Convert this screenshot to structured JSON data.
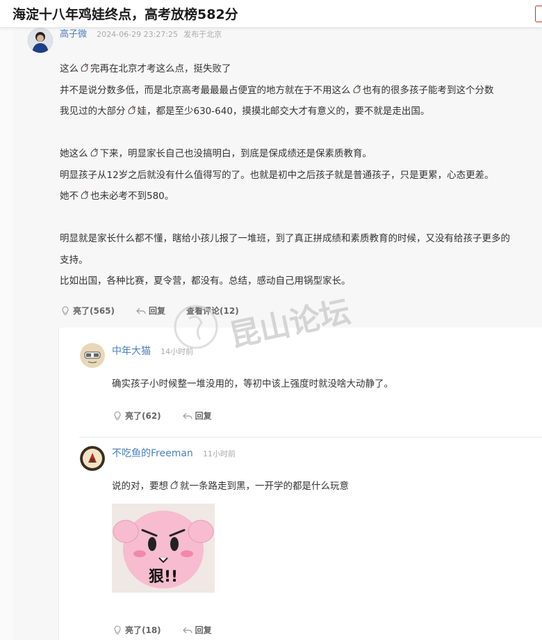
{
  "page": {
    "title": "海淀十八年鸡娃终点，高考放榜582分"
  },
  "post": {
    "author": "高子微",
    "time": "2024-06-29 23:27:25",
    "location": "发布于北京",
    "lines": [
      "这么[鸡]完再在北京才考这么点，挺失败了",
      "并不是说分数多低，而是北京高考最最最占便宜的地方就在于不用这么[鸡]也有的很多孩子能考到这个分数",
      "我见过的大部分[鸡]娃，都是至少630-640，摸摸北邮交大才有意义的，要不就是走出国。",
      "",
      "她这么[鸡]下来，明显家长自己也没搞明白，到底是保成绩还是保素质教育。",
      "明显孩子从12岁之后就没有什么值得写的了。也就是初中之后孩子就是普通孩子，只是更累，心态更差。",
      "她不[鸡]也未必考不到580。",
      "",
      "明显就是家长什么都不懂，瞎给小孩儿报了一堆班，到了真正拼成绩和素质教育的时候，又没有给孩子更多的",
      "支持。",
      "比如出国，各种比赛，夏令营，都没有。总结，感动自己用锅型家长。"
    ],
    "actions": {
      "like": "亮了(565)",
      "reply": "回复",
      "view_comments": "查看评论(12)"
    }
  },
  "replies": [
    {
      "author": "中年大猫",
      "time": "14小时前",
      "text": "确实孩子小时候整一堆没用的，等初中该上强度时就没啥大动静了。",
      "like": "亮了(62)",
      "reply": "回复"
    },
    {
      "author": "不吃鱼的Freeman",
      "time": "11小时前",
      "text": "说的对，要想[鸡]就一条路走到黑，一开学的都是什么玩意",
      "sticker_text": "狠!!",
      "like": "亮了(18)",
      "reply": "回复"
    }
  ],
  "watermark": {
    "text": "昆山论坛"
  },
  "colors": {
    "author": "#4a7fc1",
    "post_bg": "#f7f7f7",
    "watermark": "#c9c9c9"
  }
}
